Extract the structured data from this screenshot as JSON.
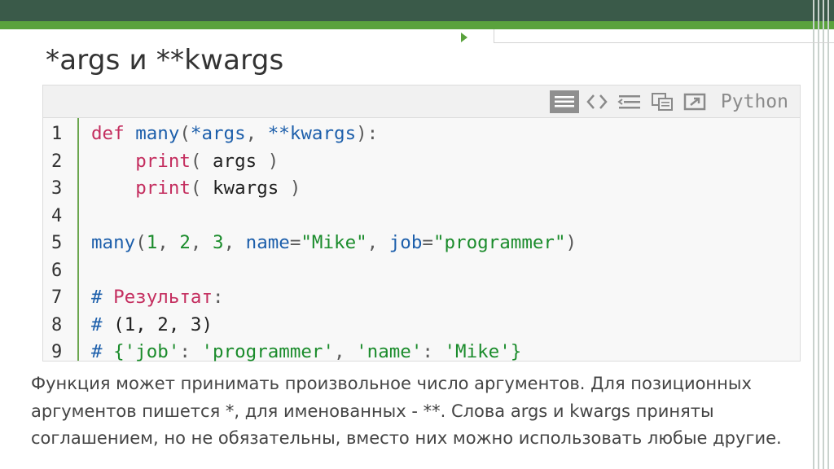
{
  "slide": {
    "title": "*args и **kwargs",
    "caption": "Функция может принимать произвольное число аргументов. Для позиционных аргументов пишется *, для именованных - **. Слова args и kwargs приняты соглашением, но не обязательны, вместо них можно использовать любые другие."
  },
  "toolbar": {
    "language": "Python",
    "icons": [
      "view-source-icon",
      "code-icon",
      "wrap-icon",
      "copy-icon",
      "popup-icon"
    ]
  },
  "code": {
    "line_numbers": [
      "1",
      "2",
      "3",
      "4",
      "5",
      "6",
      "7",
      "8",
      "9"
    ],
    "lines": [
      [
        {
          "t": "kw",
          "v": "def "
        },
        {
          "t": "fn",
          "v": "many"
        },
        {
          "t": "pr",
          "v": "("
        },
        {
          "t": "fn",
          "v": "*args"
        },
        {
          "t": "pr",
          "v": ", "
        },
        {
          "t": "fn",
          "v": "**kwargs"
        },
        {
          "t": "pr",
          "v": "):"
        }
      ],
      [
        {
          "t": "pr",
          "v": "    "
        },
        {
          "t": "kw",
          "v": "print"
        },
        {
          "t": "pr",
          "v": "( "
        },
        {
          "t": "plain",
          "v": "args"
        },
        {
          "t": "pr",
          "v": " )"
        }
      ],
      [
        {
          "t": "pr",
          "v": "    "
        },
        {
          "t": "kw",
          "v": "print"
        },
        {
          "t": "pr",
          "v": "( "
        },
        {
          "t": "plain",
          "v": "kwargs"
        },
        {
          "t": "pr",
          "v": " )"
        }
      ],
      [],
      [
        {
          "t": "fn",
          "v": "many"
        },
        {
          "t": "pr",
          "v": "("
        },
        {
          "t": "num",
          "v": "1"
        },
        {
          "t": "pr",
          "v": ", "
        },
        {
          "t": "num",
          "v": "2"
        },
        {
          "t": "pr",
          "v": ", "
        },
        {
          "t": "num",
          "v": "3"
        },
        {
          "t": "pr",
          "v": ", "
        },
        {
          "t": "fn",
          "v": "name"
        },
        {
          "t": "pr",
          "v": "="
        },
        {
          "t": "str",
          "v": "\"Mike\""
        },
        {
          "t": "pr",
          "v": ", "
        },
        {
          "t": "fn",
          "v": "job"
        },
        {
          "t": "pr",
          "v": "="
        },
        {
          "t": "str",
          "v": "\"programmer\""
        },
        {
          "t": "pr",
          "v": ")"
        }
      ],
      [],
      [
        {
          "t": "fn",
          "v": "# "
        },
        {
          "t": "kw",
          "v": "Результат"
        },
        {
          "t": "pr",
          "v": ":"
        }
      ],
      [
        {
          "t": "fn",
          "v": "# "
        },
        {
          "t": "plain",
          "v": "(1, 2, 3)"
        }
      ],
      [
        {
          "t": "fn",
          "v": "# "
        },
        {
          "t": "str",
          "v": "{'job'"
        },
        {
          "t": "pr",
          "v": ": "
        },
        {
          "t": "str",
          "v": "'programmer'"
        },
        {
          "t": "pr",
          "v": ", "
        },
        {
          "t": "str",
          "v": "'name'"
        },
        {
          "t": "pr",
          "v": ": "
        },
        {
          "t": "str",
          "v": "'Mike'"
        },
        {
          "t": "str",
          "v": "}"
        }
      ]
    ]
  }
}
